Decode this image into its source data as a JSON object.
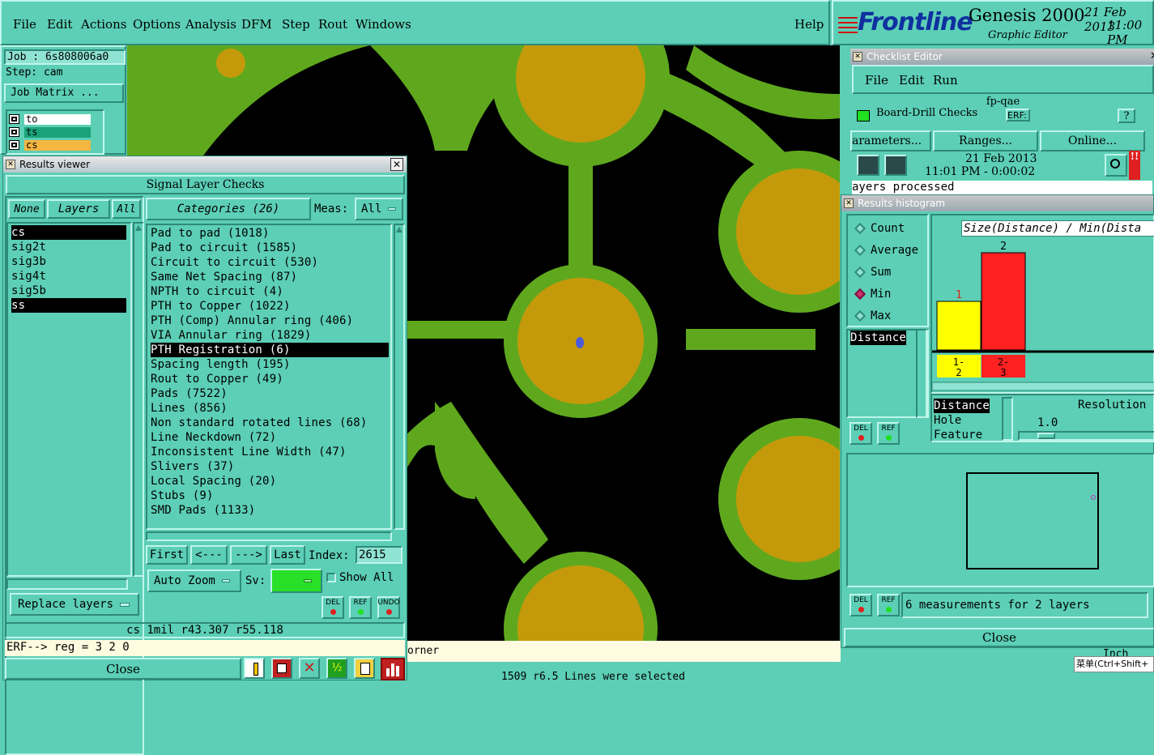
{
  "menubar": {
    "items": [
      "File",
      "Edit",
      "Actions",
      "Options",
      "Analysis",
      "DFM",
      "Step",
      "Rout",
      "Windows"
    ],
    "help": "Help"
  },
  "brand": {
    "logo": "Frontline",
    "product": "Genesis 2000",
    "subtitle": "Graphic Editor",
    "date": "21 Feb 2013",
    "time": "11:00 PM"
  },
  "job": {
    "job_label": "Job : 6s808006a0",
    "step_label": "Step: cam",
    "matrix_button": "Job Matrix ...",
    "layers": [
      {
        "name": "to",
        "color": "#ffffff"
      },
      {
        "name": "ts",
        "color": "#1aa37a"
      },
      {
        "name": "cs",
        "color": "#f5b642"
      }
    ]
  },
  "results_viewer": {
    "title": "Results viewer",
    "header_button": "Signal Layer Checks",
    "none_button": "None",
    "layers_button": "Layers",
    "all_button": "All",
    "layers": [
      "cs",
      "sig2t",
      "sig3b",
      "sig4t",
      "sig5b",
      "ss"
    ],
    "selected_layers": [
      "cs",
      "ss"
    ],
    "categories_button": "Categories (26)",
    "meas_label": "Meas:",
    "meas_value": "All",
    "categories": [
      "Pad to pad (1018)",
      "Pad to circuit (1585)",
      "Circuit to circuit (530)",
      "Same Net Spacing (87)",
      "NPTH to circuit (4)",
      "PTH to Copper (1022)",
      "PTH (Comp) Annular ring (406)",
      "VIA Annular ring (1829)",
      "PTH Registration (6)",
      "Spacing length (195)",
      "Rout to Copper (49)",
      "Pads (7522)",
      "Lines (856)",
      "Non standard rotated lines (68)",
      "Line Neckdown (72)",
      "Inconsistent Line Width (47)",
      "Slivers (37)",
      "Local Spacing (20)",
      "Stubs (9)",
      "SMD Pads (1133)"
    ],
    "selected_category": "PTH Registration (6)",
    "nav": {
      "first": "First",
      "prev": "<---",
      "next": "--->",
      "last": "Last",
      "index_label": "Index:",
      "index_value": "2615"
    },
    "auto_zoom": "Auto Zoom",
    "sv_label": "Sv:",
    "show_all": "Show All",
    "replace_layers": "Replace layers",
    "del": "DEL",
    "ref": "REF",
    "undo": "UNDO",
    "status": "cs 1mil  r43.307  r55.118",
    "erf": "ERF--> reg = 3 2 0",
    "close": "Close"
  },
  "checklist": {
    "title": "Checklist Editor",
    "menu": [
      "File",
      "Edit",
      "Run"
    ],
    "name": "fp-qae",
    "row_text": "Board-Drill Checks",
    "erf": "ERF:",
    "parameters": "arameters...",
    "ranges": "Ranges...",
    "online": "Online...",
    "date": "21 Feb 2013",
    "time": "11:01 PM - 0:00:02",
    "processed": "ayers processed"
  },
  "histogram": {
    "title": "Results histogram",
    "modes": [
      "Count",
      "Average",
      "Sum",
      "Min",
      "Max"
    ],
    "selected_mode": "Min",
    "list_top": "Distance",
    "chart_title": "Size(Distance) / Min(Dista",
    "resolution_label": "Resolution",
    "resolution_value": "1.0",
    "list_bottom": [
      "Distance",
      "Hole",
      "Feature"
    ],
    "measurements": "6 measurements for 2 layers",
    "del": "DEL",
    "ref": "REF",
    "close": "Close",
    "bars": [
      {
        "label": "1",
        "range": "1-\n2",
        "value": 1,
        "color": "#ffff00"
      },
      {
        "label": "2",
        "range": "2-\n3",
        "value": 2,
        "color": "#ff2020"
      }
    ]
  },
  "bottom": {
    "corner_text": "orner",
    "status": "1509 r6.5 Lines were selected",
    "inch": "Inch",
    "ime": "菜单(Ctrl+Shift+"
  },
  "colors": {
    "ui_teal": "#5ccfb6",
    "copper_green": "#5fa81e",
    "pad_gold": "#c49a0a",
    "canvas": "#000000"
  }
}
